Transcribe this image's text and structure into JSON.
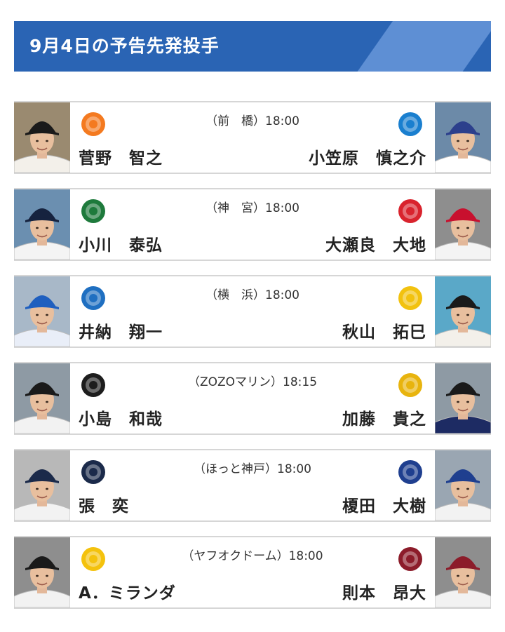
{
  "header": {
    "title": "9月4日の予告先発投手"
  },
  "games": [
    {
      "venue": "（前　橋）18:00",
      "home": {
        "pitcher": "菅野　智之",
        "logo_icon": "giants-logo-icon",
        "logo_color": "#f47a20"
      },
      "away": {
        "pitcher": "小笠原　慎之介",
        "logo_icon": "dragons-logo-icon",
        "logo_color": "#1a7fcf"
      }
    },
    {
      "venue": "（神　宮）18:00",
      "home": {
        "pitcher": "小川　泰弘",
        "logo_icon": "swallows-logo-icon",
        "logo_color": "#1e7a3c"
      },
      "away": {
        "pitcher": "大瀬良　大地",
        "logo_icon": "carp-logo-icon",
        "logo_color": "#d9232d"
      }
    },
    {
      "venue": "（横　浜）18:00",
      "home": {
        "pitcher": "井納　翔一",
        "logo_icon": "baystars-logo-icon",
        "logo_color": "#1f6fc1"
      },
      "away": {
        "pitcher": "秋山　拓巳",
        "logo_icon": "tigers-logo-icon",
        "logo_color": "#f2c20f"
      }
    },
    {
      "venue": "（ZOZOマリン）18:15",
      "home": {
        "pitcher": "小島　和哉",
        "logo_icon": "marines-logo-icon",
        "logo_color": "#1d1d1d"
      },
      "away": {
        "pitcher": "加藤　貴之",
        "logo_icon": "fighters-logo-icon",
        "logo_color": "#e8b40e"
      }
    },
    {
      "venue": "（ほっと神戸）18:00",
      "home": {
        "pitcher": "張　奕",
        "logo_icon": "buffaloes-logo-icon",
        "logo_color": "#1b2a4a"
      },
      "away": {
        "pitcher": "榎田　大樹",
        "logo_icon": "lions-logo-icon",
        "logo_color": "#1f3f8f"
      }
    },
    {
      "venue": "（ヤフオクドーム）18:00",
      "home": {
        "pitcher": "A．ミランダ",
        "logo_icon": "hawks-logo-icon",
        "logo_color": "#f4c20d"
      },
      "away": {
        "pitcher": "則本　昂大",
        "logo_icon": "eagles-logo-icon",
        "logo_color": "#8c1c2a"
      }
    }
  ]
}
